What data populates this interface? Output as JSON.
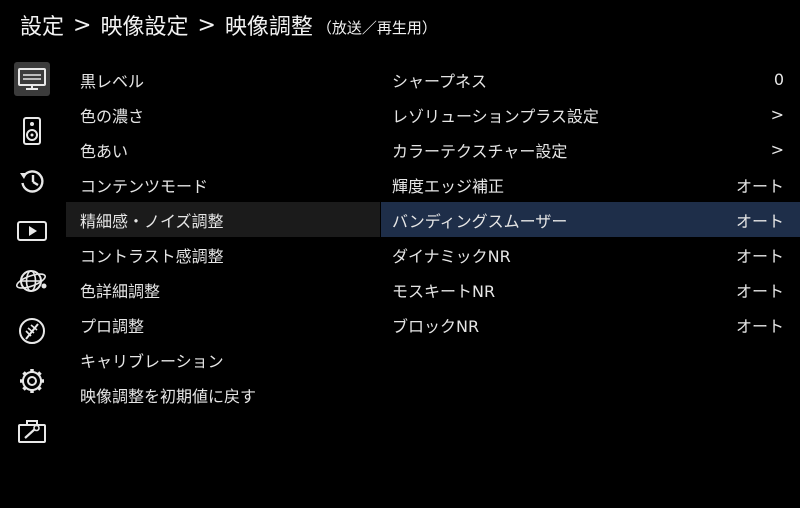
{
  "breadcrumb": {
    "level1": "設定",
    "level2": "映像設定",
    "level3": "映像調整",
    "context": "（放送／再生用）",
    "separator": ">"
  },
  "sidebar_icons": [
    {
      "icon": "monitor-icon",
      "selected": true
    },
    {
      "icon": "speaker-icon",
      "selected": false
    },
    {
      "icon": "history-icon",
      "selected": false
    },
    {
      "icon": "play-icon",
      "selected": false
    },
    {
      "icon": "globe-network-icon",
      "selected": false
    },
    {
      "icon": "antenna-icon",
      "selected": false
    },
    {
      "icon": "gear-icon",
      "selected": false
    },
    {
      "icon": "toolbox-icon",
      "selected": false
    }
  ],
  "left_menu": [
    {
      "label": "黒レベル"
    },
    {
      "label": "色の濃さ"
    },
    {
      "label": "色あい"
    },
    {
      "label": "コンテンツモード"
    },
    {
      "label": "精細感・ノイズ調整",
      "active": true
    },
    {
      "label": "コントラスト感調整"
    },
    {
      "label": "色詳細調整"
    },
    {
      "label": "プロ調整"
    },
    {
      "label": "キャリブレーション"
    },
    {
      "label": "映像調整を初期値に戻す"
    }
  ],
  "right_menu": [
    {
      "label": "シャープネス",
      "value": "0"
    },
    {
      "label": "レゾリューションプラス設定",
      "value": ">"
    },
    {
      "label": "カラーテクスチャー設定",
      "value": ">"
    },
    {
      "label": "輝度エッジ補正",
      "value": "オート"
    },
    {
      "label": "バンディングスムーザー",
      "value": "オート",
      "selected": true
    },
    {
      "label": "ダイナミックNR",
      "value": "オート"
    },
    {
      "label": "モスキートNR",
      "value": "オート"
    },
    {
      "label": "ブロックNR",
      "value": "オート"
    }
  ],
  "colors": {
    "background": "#000000",
    "text": "#e6e6e6",
    "selected_row": "#1e2e49",
    "active_left_row": "#1b1b1b",
    "selected_icon_bg": "#3b3b3b"
  }
}
